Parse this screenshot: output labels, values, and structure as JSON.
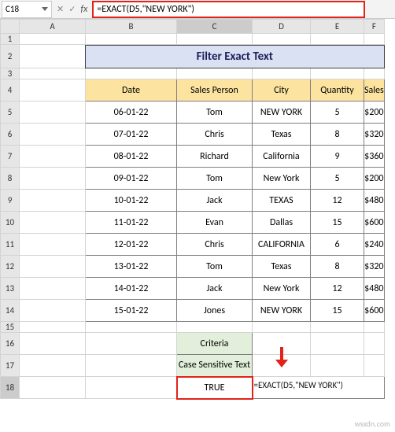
{
  "nameBox": "C18",
  "fxIcons": {
    "cancel": "✕",
    "confirm": "✓",
    "fx": "fx"
  },
  "formulaBar": "=EXACT(D5,\"NEW YORK\")",
  "title": "Filter Exact Text",
  "columns": [
    "",
    "A",
    "B",
    "C",
    "D",
    "E",
    "F",
    ""
  ],
  "headers": {
    "date": "Date",
    "sp": "Sales Person",
    "city": "City",
    "qty": "Quantity",
    "sales": "Sales"
  },
  "rows": [
    {
      "date": "06-01-22",
      "sp": "Tom",
      "city": "NEW YORK",
      "qty": "5",
      "sales": "$200"
    },
    {
      "date": "07-01-22",
      "sp": "Chris",
      "city": "Texas",
      "qty": "8",
      "sales": "$320"
    },
    {
      "date": "08-01-22",
      "sp": "Richard",
      "city": "California",
      "qty": "9",
      "sales": "$360"
    },
    {
      "date": "09-01-22",
      "sp": "Tom",
      "city": "New York",
      "qty": "5",
      "sales": "$200"
    },
    {
      "date": "10-01-22",
      "sp": "Jack",
      "city": "TEXAS",
      "qty": "12",
      "sales": "$480"
    },
    {
      "date": "11-01-22",
      "sp": "Evan",
      "city": "Dallas",
      "qty": "15",
      "sales": "$600"
    },
    {
      "date": "12-01-22",
      "sp": "Chris",
      "city": "CALIFORNIA",
      "qty": "6",
      "sales": "$240"
    },
    {
      "date": "13-01-22",
      "sp": "Tom",
      "city": "Texas",
      "qty": "8",
      "sales": "$320"
    },
    {
      "date": "14-01-22",
      "sp": "Jack",
      "city": "New York",
      "qty": "12",
      "sales": "$480"
    },
    {
      "date": "15-01-22",
      "sp": "Jones",
      "city": "NEW YORK",
      "qty": "15",
      "sales": "$600"
    }
  ],
  "criteria": {
    "hdr": "Criteria",
    "sub": "Case Sensitive Text",
    "val": "TRUE"
  },
  "annot": "=EXACT(D5,\"NEW YORK\")",
  "rowNums": [
    "1",
    "2",
    "3",
    "4",
    "5",
    "6",
    "7",
    "8",
    "9",
    "10",
    "11",
    "12",
    "13",
    "14",
    "15",
    "16",
    "17",
    "18"
  ],
  "watermark": "wsxdn.com"
}
